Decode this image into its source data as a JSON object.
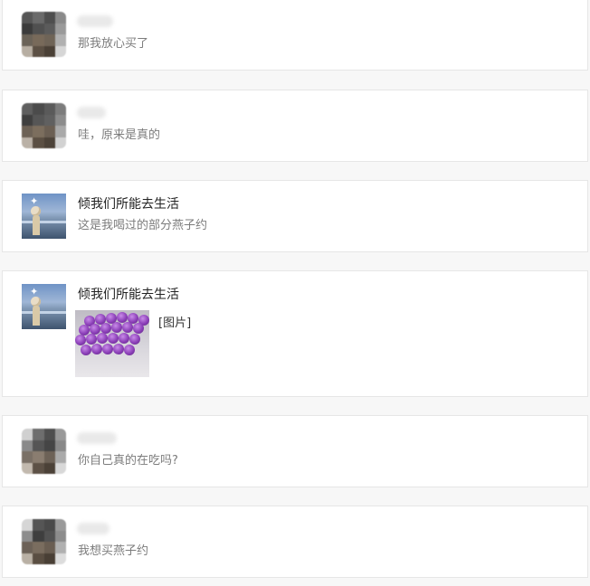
{
  "comments": [
    {
      "name": "",
      "name_hidden": true,
      "message": "那我放心买了"
    },
    {
      "name": "",
      "name_hidden": true,
      "message": "哇，原来是真的"
    },
    {
      "name": "倾我们所能去生活",
      "name_hidden": false,
      "message": "这是我喝过的部分燕子约"
    },
    {
      "name": "倾我们所能去生活",
      "name_hidden": false,
      "message": "",
      "image_label": "[图片]"
    },
    {
      "name": "",
      "name_hidden": true,
      "message": "你自己真的在吃吗?"
    },
    {
      "name": "",
      "name_hidden": true,
      "message": "我想买燕子约"
    }
  ],
  "colors": {
    "card_bg": "#ffffff",
    "border": "#e6e6e6",
    "name_text": "#222222",
    "message_text": "#7c7c7c",
    "vial_cap": "#8b3fb8"
  },
  "icons": {
    "blurred_avatar": "blurred-avatar-icon",
    "seaside_avatar": "seaside-avatar-icon"
  }
}
